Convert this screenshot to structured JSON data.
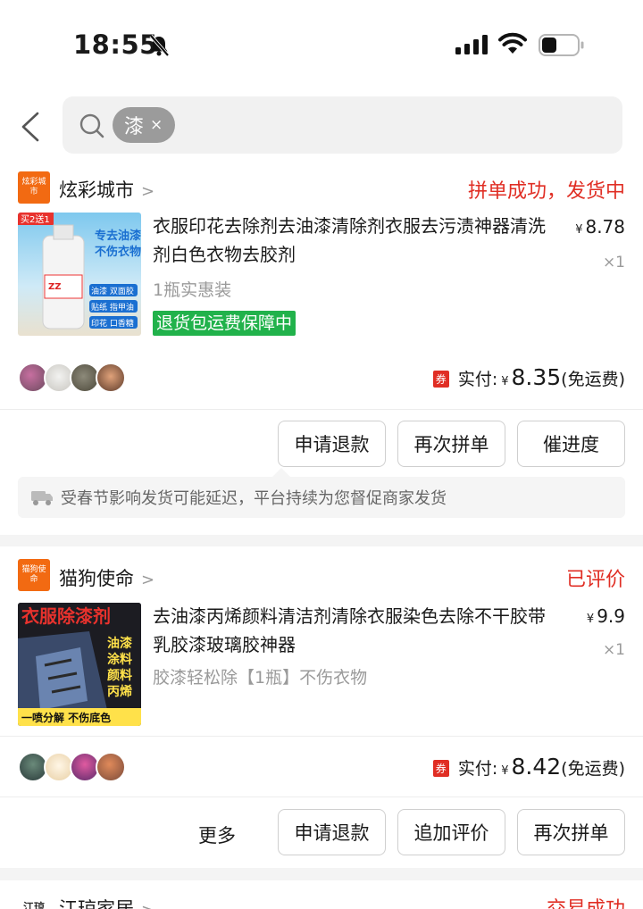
{
  "status_bar": {
    "time": "18:55"
  },
  "search": {
    "chip_text": "漆",
    "chip_close": "×"
  },
  "orders": [
    {
      "shop_logo_text": "炫彩城市",
      "shop_name": "炫彩城市",
      "status": "拼单成功，发货中",
      "thumb_badge": "买2送1",
      "thumb_texts": [
        "专去油漆",
        "不伤衣物",
        "油漆 双面胶",
        "贴纸 指甲油",
        "印花 口香糖"
      ],
      "title": "衣服印花去除剂去油漆清除剂衣服去污渍神器清洗剂白色衣物去胶剂",
      "spec": "1瓶实惠装",
      "tag": "退货包运费保障中",
      "yen": "¥",
      "price": "8.78",
      "qty": "×1",
      "coupon": "券",
      "paid_label": "实付:",
      "paid_amount": "8.35",
      "paid_note": "(免运费)",
      "buttons": [
        "申请退款",
        "再次拼单",
        "催进度"
      ],
      "notice": "受春节影响发货可能延迟，平台持续为您督促商家发货"
    },
    {
      "shop_logo_text": "猫狗使命",
      "shop_name": "猫狗使命",
      "status": "已评价",
      "thumb_texts": [
        "衣服除漆剂",
        "油漆",
        "涂料",
        "颜料",
        "丙烯",
        "一喷分解 不伤底色"
      ],
      "title": "去油漆丙烯颜料清洁剂清除衣服染色去除不干胶带乳胶漆玻璃胶神器",
      "spec": "胶漆轻松除【1瓶】不伤衣物",
      "yen": "¥",
      "price": "9.9",
      "qty": "×1",
      "coupon": "券",
      "paid_label": "实付:",
      "paid_amount": "8.42",
      "paid_note": "(免运费)",
      "more": "更多",
      "buttons": [
        "申请退款",
        "追加评价",
        "再次拼单"
      ]
    },
    {
      "shop_logo_text": "江琼",
      "shop_name": "江琼家居",
      "status": "交易成功"
    }
  ],
  "colors": {
    "accent_red": "#e02e24",
    "shop_orange": "#f26a12",
    "guarantee_green": "#21b24b"
  }
}
